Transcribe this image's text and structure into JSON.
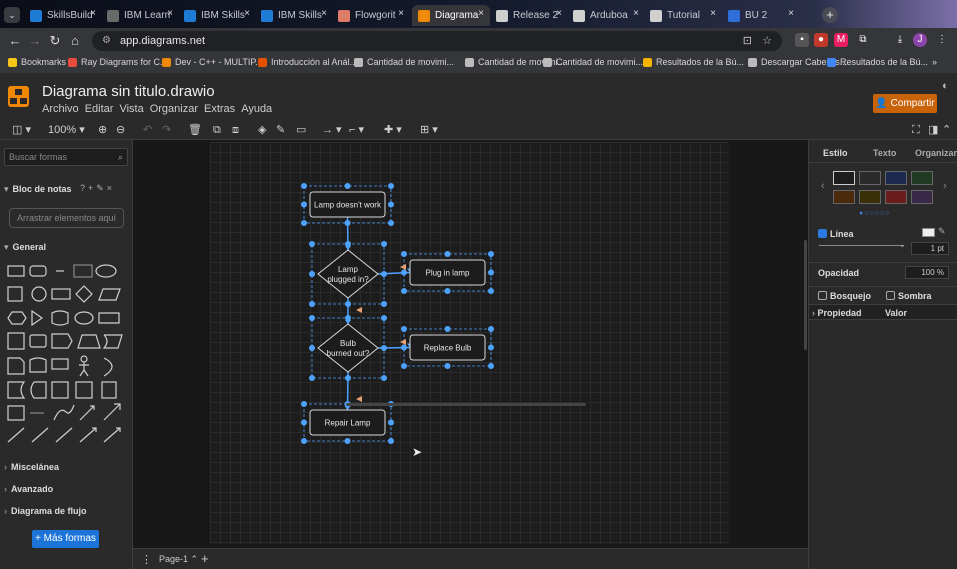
{
  "browser": {
    "tabs": [
      {
        "title": "SkillsBuild",
        "color": "#1e7bd6"
      },
      {
        "title": "IBM Learn",
        "color": "#6a6a6a"
      },
      {
        "title": "IBM Skills",
        "color": "#1e7bd6"
      },
      {
        "title": "IBM Skills",
        "color": "#1e7bd6"
      },
      {
        "title": "Flowgorit",
        "color": "#e07b6a"
      },
      {
        "title": "Diagrama",
        "color": "#f08705"
      },
      {
        "title": "Release 2",
        "color": "#cfcfcf"
      },
      {
        "title": "Arduboa",
        "color": "#d0d0d0"
      },
      {
        "title": "Tutorial",
        "color": "#d0d0d0"
      },
      {
        "title": "BU 2",
        "color": "#2d6ed8"
      }
    ],
    "tab_close": "×",
    "new_tab": "+",
    "url": "app.diagrams.net",
    "bookmarks": [
      {
        "label": "Bookmarks",
        "color": "#f5c518"
      },
      {
        "label": "Ray Diagrams for C...",
        "color": "#e74c3c"
      },
      {
        "label": "Dev - C++ - MULTIP...",
        "color": "#f08705"
      },
      {
        "label": "Introducción al Anál...",
        "color": "#e65100"
      },
      {
        "label": "Cantidad de movimi...",
        "color": "#bbbbbb"
      },
      {
        "label": "Cantidad de movimi...",
        "color": "#bbbbbb"
      },
      {
        "label": "Cantidad de movimi...",
        "color": "#bbbbbb"
      },
      {
        "label": "Resultados de la Bú...",
        "color": "#f4b400"
      },
      {
        "label": "Descargar Cabela's...",
        "color": "#bbbbbb"
      },
      {
        "label": "Resultados de la Bú...",
        "color": "#4285f4"
      }
    ],
    "bookmarks_more": "»"
  },
  "app": {
    "title": "Diagrama sin titulo.drawio",
    "menu": [
      "Archivo",
      "Editar",
      "Vista",
      "Organizar",
      "Extras",
      "Ayuda"
    ],
    "share_label": "Compartir",
    "zoom": "100%",
    "page_tab": "Page-1"
  },
  "left_panel": {
    "search_placeholder": "Buscar formas",
    "scratchpad_title": "Bloc de notas",
    "scratchpad_drop": "Arrastrar elementos aquí",
    "general_title": "General",
    "sections": [
      "Miscelánea",
      "Avanzado",
      "Diagrama de flujo"
    ],
    "more_shapes": "+ Más formas"
  },
  "right_panel": {
    "tabs": [
      "Estilo",
      "Texto",
      "Organizar"
    ],
    "line_label": "Línea",
    "line_width": "1 pt",
    "opacity_label": "Opacidad",
    "opacity_value": "100 %",
    "sketch_label": "Bosquejo",
    "shadow_label": "Sombra",
    "property_label": "Propiedad",
    "value_label": "Valor",
    "swatches": [
      "#1e1e1e",
      "#2b2b2b",
      "#1b2a4e",
      "#1e3a22",
      "#4a2a0a",
      "#3a3008",
      "#6a1c1c",
      "#3a2848"
    ]
  },
  "diagram": {
    "nodes": [
      {
        "id": "start",
        "text": "Lamp doesn't work",
        "shape": "rect"
      },
      {
        "id": "d1",
        "text": "Lamp plugged in?",
        "shape": "diamond"
      },
      {
        "id": "a1",
        "text": "Plug in lamp",
        "shape": "rect"
      },
      {
        "id": "d2",
        "text": "Bulb burned out?",
        "shape": "diamond"
      },
      {
        "id": "a2",
        "text": "Replace Bulb",
        "shape": "rect"
      },
      {
        "id": "end",
        "text": "Repair Lamp",
        "shape": "rect"
      }
    ],
    "edges": [
      {
        "from": "start",
        "to": "d1"
      },
      {
        "from": "d1",
        "to": "a1"
      },
      {
        "from": "d1",
        "to": "d2"
      },
      {
        "from": "d2",
        "to": "a2"
      },
      {
        "from": "d2",
        "to": "end"
      }
    ],
    "selection_color": "#4da3ff"
  }
}
